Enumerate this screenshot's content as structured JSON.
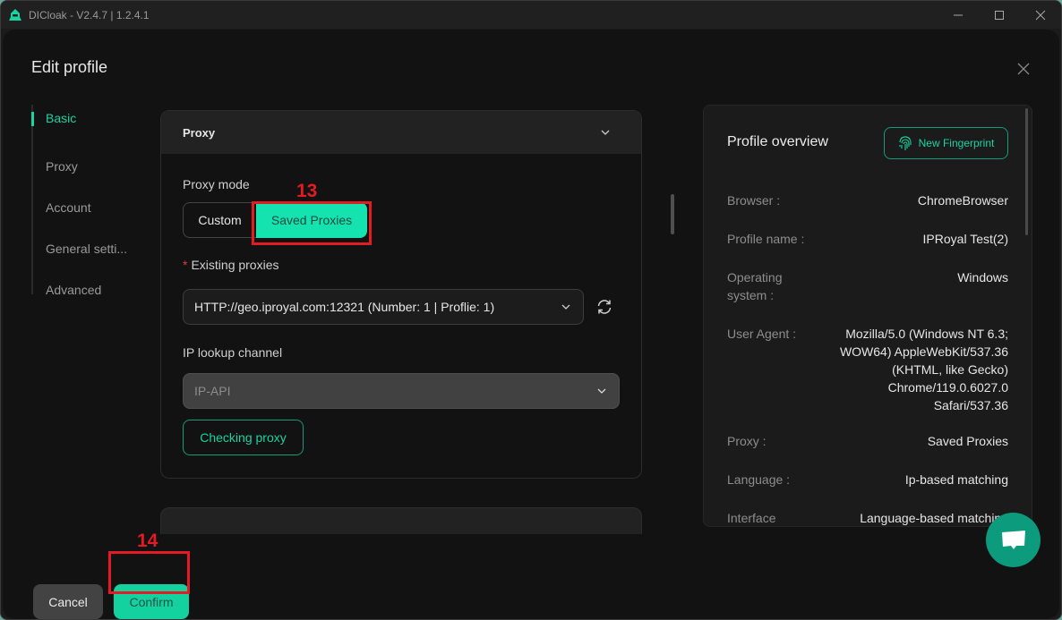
{
  "titlebar": {
    "title": "DICloak - V2.4.7 | 1.2.4.1",
    "logo_icon": "dicloak-logo-icon",
    "minimize_icon": "minimize-icon",
    "maximize_icon": "maximize-icon",
    "close_icon": "close-icon"
  },
  "dialog": {
    "title": "Edit profile",
    "close_icon": "close-icon"
  },
  "nav": {
    "items": [
      {
        "label": "Basic",
        "active": true
      },
      {
        "label": "Proxy",
        "active": false
      },
      {
        "label": "Account",
        "active": false
      },
      {
        "label": "General setti...",
        "active": false
      },
      {
        "label": "Advanced",
        "active": false
      }
    ]
  },
  "proxy_card": {
    "header": "Proxy",
    "proxy_mode_label": "Proxy mode",
    "modes": [
      "Custom",
      "Saved Proxies"
    ],
    "selected_mode": "Saved Proxies",
    "existing_proxies_required": "*",
    "existing_proxies_label": "Existing proxies",
    "existing_proxies_value": "HTTP://geo.iproyal.com:12321 (Number: 1 | Proflie: 1)",
    "ip_lookup_label": "IP lookup channel",
    "ip_lookup_value": "IP-API",
    "check_button": "Checking proxy"
  },
  "overview": {
    "title": "Profile overview",
    "new_fingerprint_button": "New Fingerprint",
    "rows": [
      {
        "key": "Browser :",
        "value": "ChromeBrowser"
      },
      {
        "key": "Profile name :",
        "value": "IPRoyal Test(2)"
      },
      {
        "key": "Operating system :",
        "value": "Windows"
      },
      {
        "key": "User Agent :",
        "value": "Mozilla/5.0 (Windows NT 6.3; WOW64) AppleWebKit/537.36 (KHTML, like Gecko) Chrome/119.0.6027.0 Safari/537.36"
      },
      {
        "key": "Proxy :",
        "value": "Saved Proxies"
      },
      {
        "key": "Language :",
        "value": "Ip-based matching"
      },
      {
        "key": "Interface",
        "value": "Language-based matching"
      }
    ]
  },
  "footer": {
    "cancel": "Cancel",
    "confirm": "Confirm"
  },
  "annotations": [
    {
      "number": "13",
      "target": "Saved Proxies"
    },
    {
      "number": "14",
      "target": "Confirm"
    }
  ],
  "colors": {
    "accent": "#14e3b0",
    "annotation": "#e41b23",
    "background": "#121212"
  }
}
